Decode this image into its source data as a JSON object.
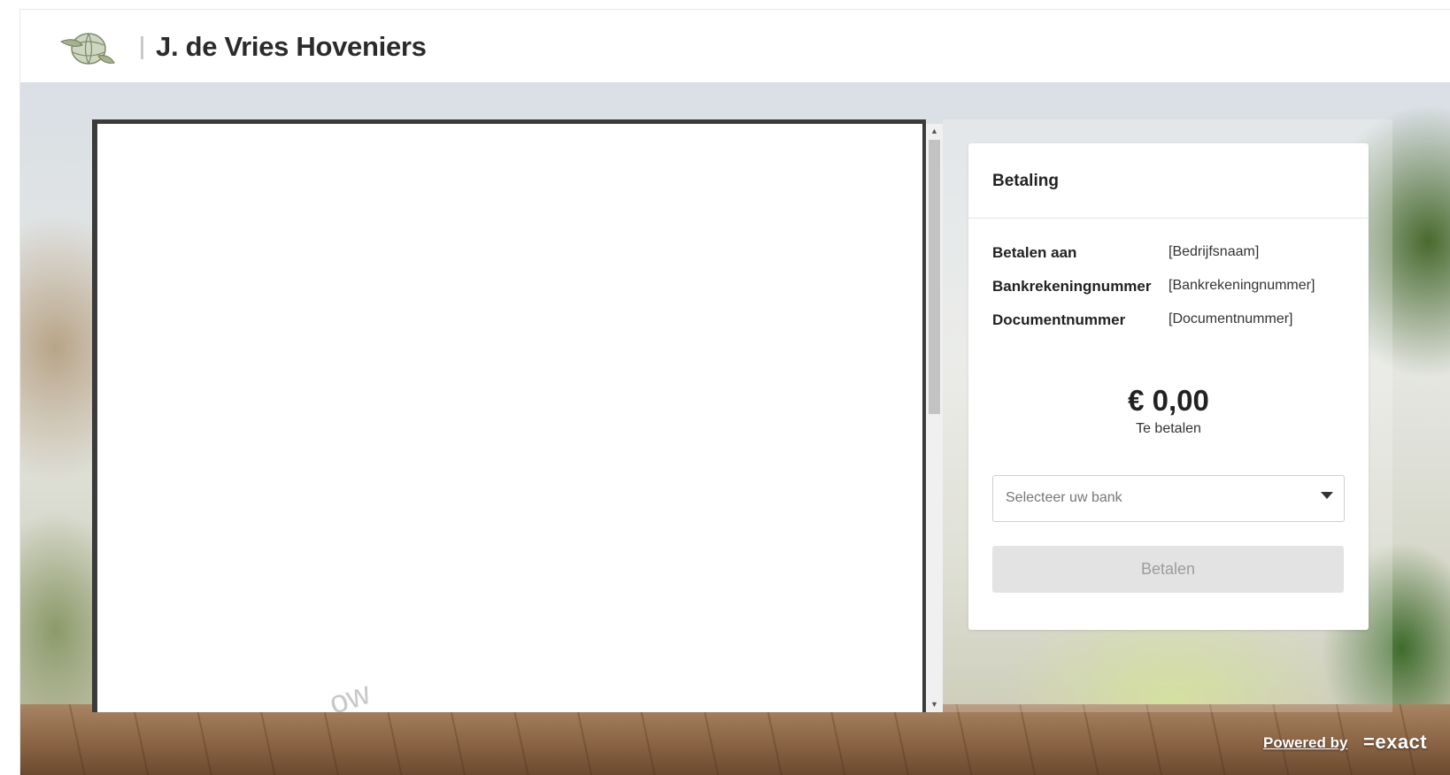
{
  "header": {
    "company_name": "J. de Vries Hoveniers",
    "logo_icon": "globe-leaf-logo-icon"
  },
  "viewer": {
    "watermark_fragment": "ow",
    "scroll_up_icon": "scroll-up-arrow-icon",
    "scroll_down_icon": "scroll-down-arrow-icon"
  },
  "payment": {
    "title": "Betaling",
    "rows": [
      {
        "label": "Betalen aan",
        "value": "[Bedrijfsnaam]"
      },
      {
        "label": "Bankrekeningnummer",
        "value": "[Bankrekeningnummer]"
      },
      {
        "label": "Documentnummer",
        "value": "[Documentnummer]"
      }
    ],
    "amount": "€ 0,00",
    "amount_caption": "Te betalen",
    "bank_select": {
      "placeholder": "Selecteer uw bank",
      "caret_icon": "caret-down-icon"
    },
    "pay_button_label": "Betalen"
  },
  "footer": {
    "powered_by": "Powered by",
    "brand": "=exact"
  },
  "colors": {
    "brand_text": "#2b2b2b",
    "button_disabled_bg": "#e3e3e3",
    "button_disabled_text": "#9c9c9c"
  }
}
